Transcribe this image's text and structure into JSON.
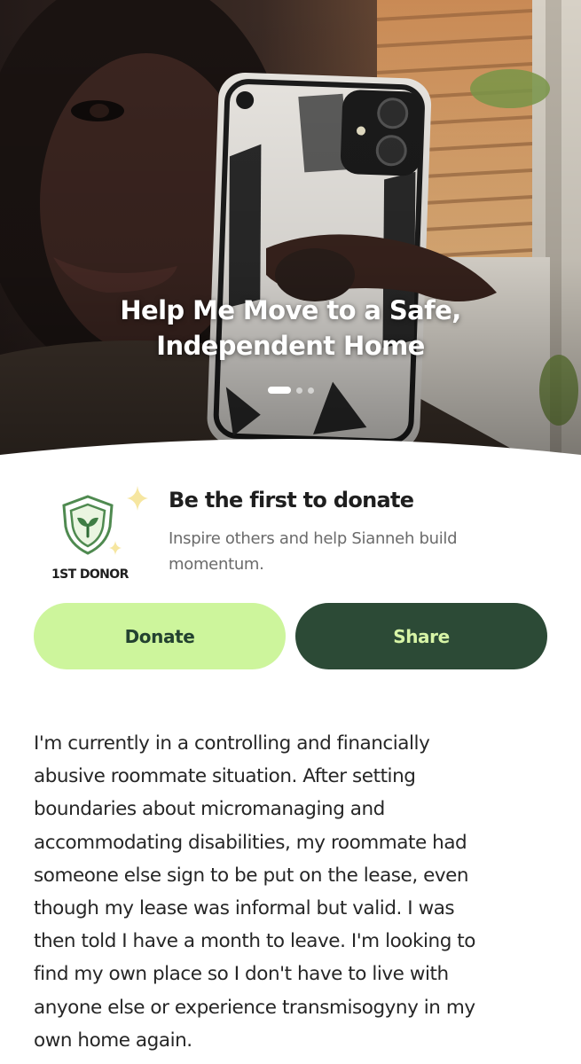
{
  "campaign": {
    "title_lines": [
      "Help Me Move to a Safe,",
      "Independent Home"
    ],
    "carousel": {
      "total": 3,
      "active": 1
    }
  },
  "first_donor": {
    "badge_label": "1ST DONOR",
    "badge_icon": "shield-seedling-icon",
    "title": "Be the first to donate",
    "subtitle_lines": [
      "Inspire others and help Sianneh build",
      "momentum."
    ]
  },
  "actions": {
    "donate_label": "Donate",
    "share_label": "Share"
  },
  "story": {
    "lines": [
      "I'm currently in a controlling and financially",
      "abusive roommate situation. After setting",
      "boundaries about micromanaging and",
      "accommodating disabilities, my roommate had",
      "someone else sign to be put on the lease, even",
      "though my lease was informal but valid. I was",
      "then told I have a month to leave. I'm looking to",
      "find my own place so I don't have to live with",
      "anyone else or experience transmisogyny in my",
      "own home again."
    ]
  },
  "colors": {
    "donate_bg": "#cdf59c",
    "donate_text": "#234230",
    "share_bg": "#2c4a36",
    "share_text": "#d7f4a6",
    "badge_green": "#2e7d32",
    "sparkle": "#f6e6a0"
  }
}
